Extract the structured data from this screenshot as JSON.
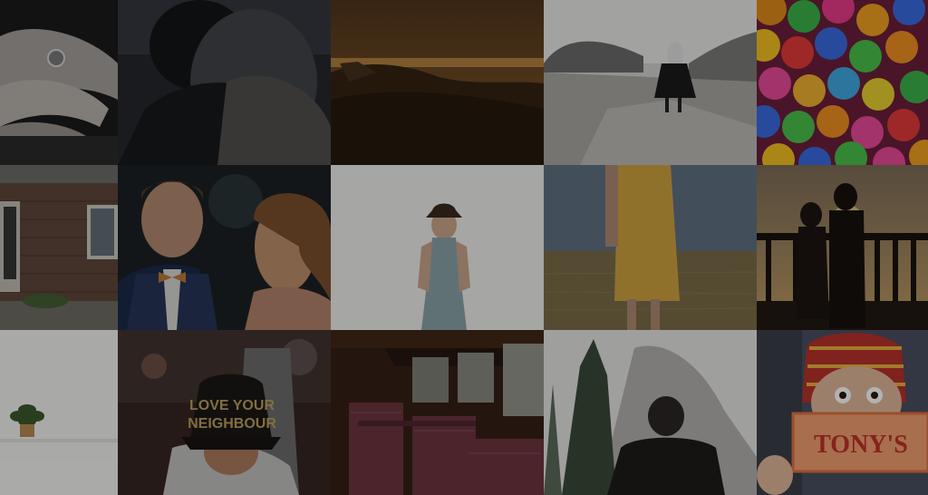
{
  "gallery": {
    "tiles": [
      {
        "subject": "hand with ring"
      },
      {
        "subject": "couple embracing"
      },
      {
        "subject": "sunset over hills"
      },
      {
        "subject": "woman walking on rocky shore"
      },
      {
        "subject": "colorful gumballs"
      },
      {
        "subject": "brick house"
      },
      {
        "subject": "smiling couple at wedding"
      },
      {
        "subject": "woman in hat"
      },
      {
        "subject": "yellow dress in field"
      },
      {
        "subject": "couple on balcony at sunset"
      },
      {
        "subject": "plant on shelf"
      },
      {
        "subject": "man in cap",
        "cap_text": "LOVE YOUR NEIGHBOUR"
      },
      {
        "subject": "train interior seats"
      },
      {
        "subject": "man facing mountain"
      },
      {
        "subject": "child with chocolate bar",
        "bar_text": "TONY'S"
      }
    ]
  }
}
